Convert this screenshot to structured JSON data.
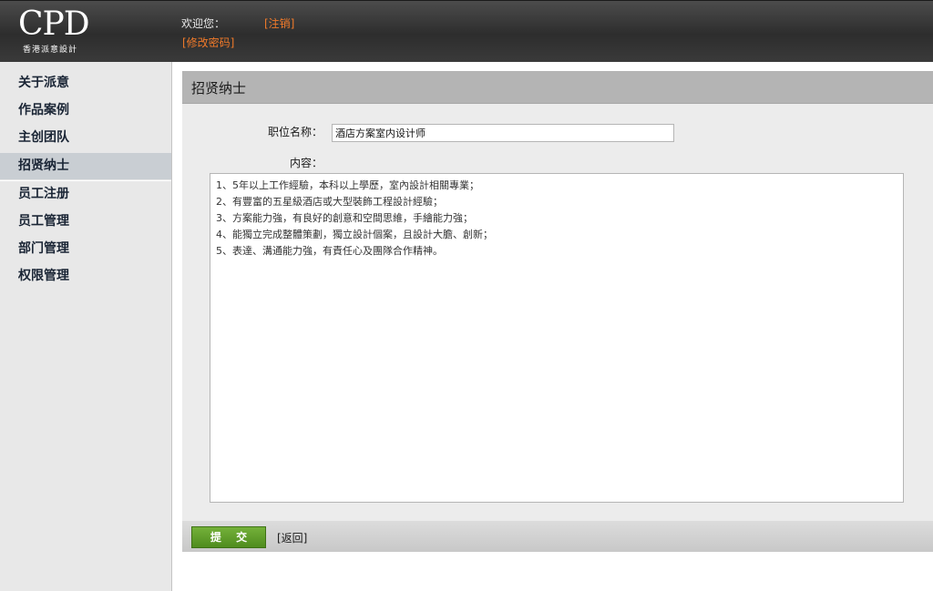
{
  "header": {
    "logo_main": "CPD",
    "logo_sub": "香港派意設計",
    "welcome": "欢迎您：",
    "logout": "[注销]",
    "change_password": "[修改密码]"
  },
  "sidebar": {
    "items": [
      {
        "label": "关于派意"
      },
      {
        "label": "作品案例"
      },
      {
        "label": "主创团队"
      },
      {
        "label": "招贤纳士"
      },
      {
        "label": "员工注册"
      },
      {
        "label": "员工管理"
      },
      {
        "label": "部门管理"
      },
      {
        "label": "权限管理"
      }
    ]
  },
  "main": {
    "title": "招贤纳士",
    "position_label": "职位名称：",
    "position_value": "酒店方案室内设计师",
    "content_label": "内容：",
    "content_value": "1、5年以上工作經驗，本科以上學歷，室內設計相關專業；\n2、有豐富的五星級酒店或大型裝飾工程設計經驗；\n3、方案能力強，有良好的創意和空間思維，手繪能力強；\n4、能獨立完成整體策劃，獨立設計個案，且設計大膽、創新；\n5、表達、溝通能力強，有責任心及團隊合作精神。",
    "submit_label": "提 交",
    "back_label": "[返回]"
  },
  "colors": {
    "accent_orange": "#f07a2a",
    "submit_green": "#5e9c28",
    "header_dark": "#333333"
  }
}
